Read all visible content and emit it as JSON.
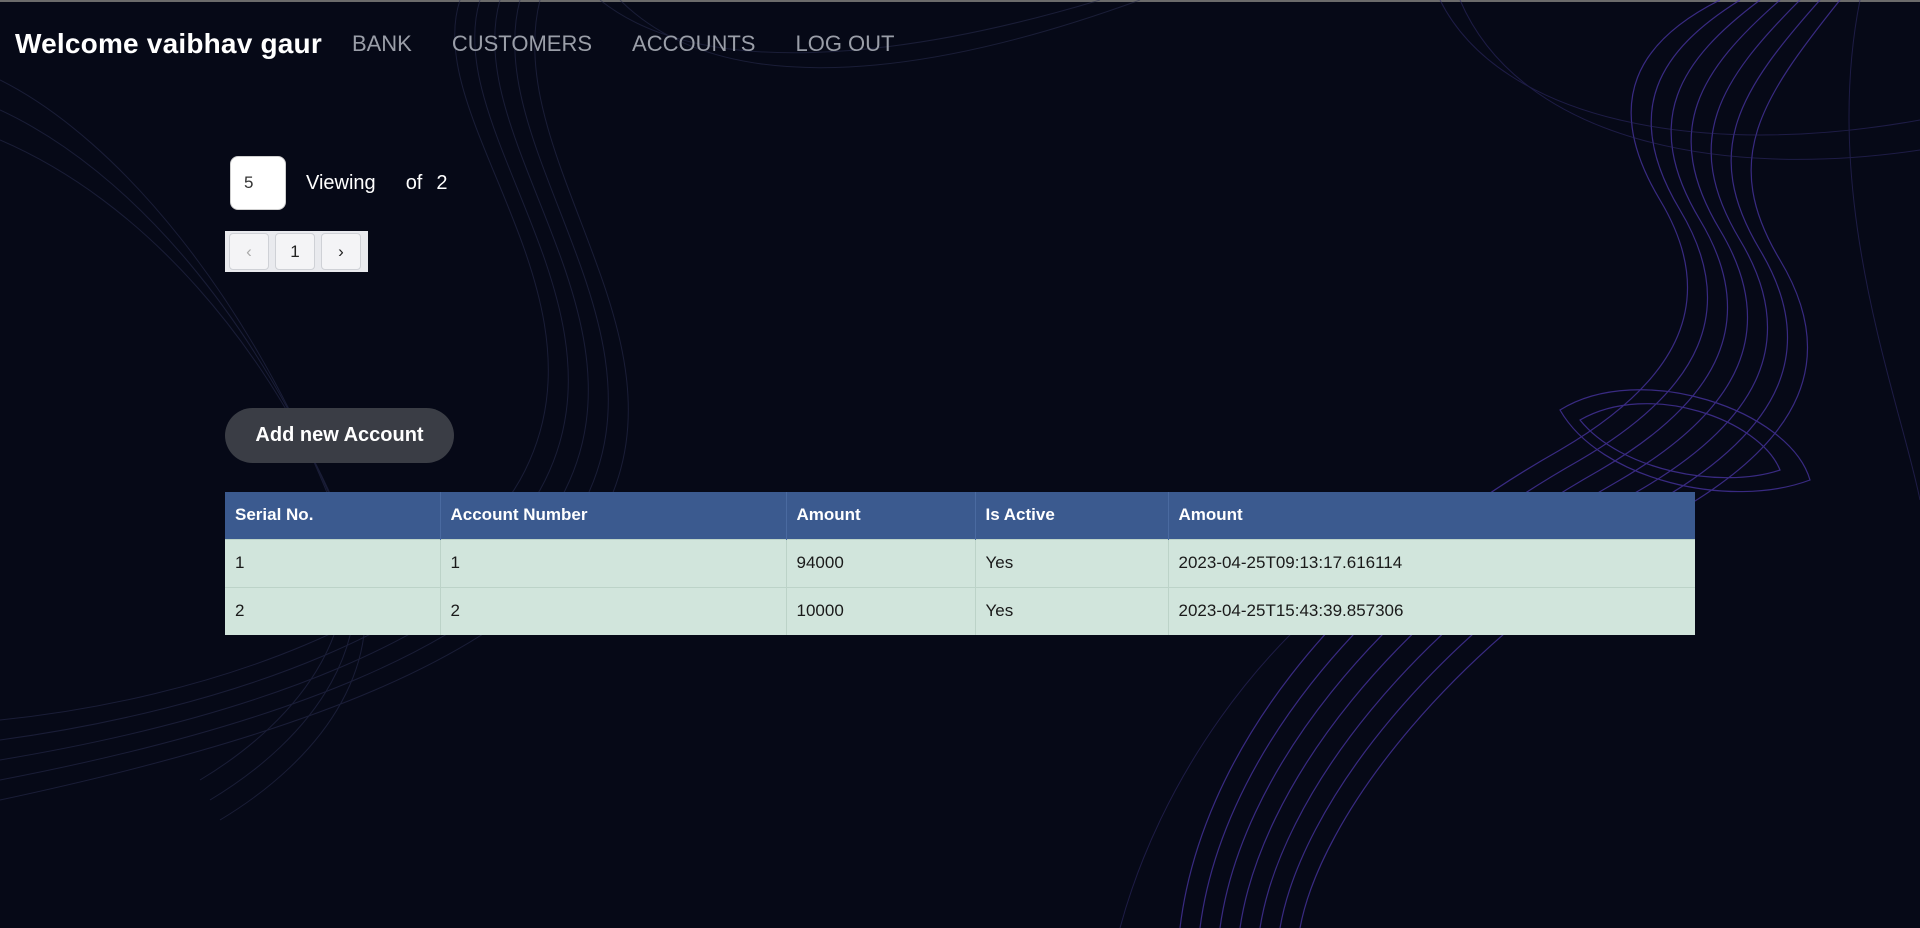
{
  "header": {
    "welcome": "Welcome vaibhav gaur",
    "nav": [
      "BANK",
      "CUSTOMERS",
      "ACCOUNTS",
      "LOG OUT"
    ]
  },
  "pagination": {
    "page_size": "5",
    "viewing_label": "Viewing",
    "of_label": "of",
    "total": "2",
    "current_page": "1",
    "prev_icon": "‹",
    "next_icon": "›"
  },
  "actions": {
    "add_account": "Add new Account"
  },
  "table": {
    "headers": [
      "Serial No.",
      "Account Number",
      "Amount",
      "Is Active",
      "Amount"
    ],
    "rows": [
      [
        "1",
        "1",
        "94000",
        "Yes",
        "2023-04-25T09:13:17.616114"
      ],
      [
        "2",
        "2",
        "10000",
        "Yes",
        "2023-04-25T15:43:39.857306"
      ]
    ]
  },
  "colors": {
    "background": "#060917",
    "table_header": "#3b5a8f",
    "table_row": "#d1e5dc",
    "wave_accent": "#5b3fc4"
  }
}
